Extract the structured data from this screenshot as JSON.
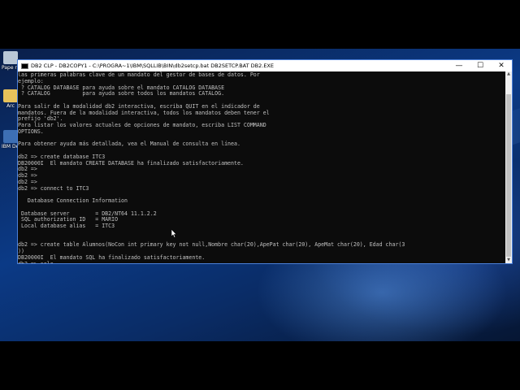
{
  "window": {
    "title": "DB2 CLP - DB2COPY1 - C:\\PROGRA~1\\IBM\\SQLLIB\\BIN\\db2setcp.bat  DB2SETCP.BAT DB2.EXE",
    "minimize": "—",
    "maximize": "☐",
    "close": "✕"
  },
  "desktop_icons": [
    {
      "label": "Pape rec",
      "icon": "recycle-bin-icon",
      "color": "#b9c7d6"
    },
    {
      "label": "Arc",
      "icon": "folder-icon",
      "color": "#e8c25a"
    },
    {
      "label": "IBM Devel",
      "icon": "ibm-app-icon",
      "color": "#3d6fb4"
    }
  ],
  "console_lines": [
    "las primeras palabras clave de un mandato del gestor de bases de datos. Por",
    "ejemplo:",
    " ? CATALOG DATABASE para ayuda sobre el mandato CATALOG DATABASE",
    " ? CATALOG          para ayuda sobre todos los mandatos CATALOG.",
    "",
    "Para salir de la modalidad db2 interactiva, escriba QUIT en el indicador de",
    "mandatos. Fuera de la modalidad interactiva, todos los mandatos deben tener el",
    "prefijo 'db2'.",
    "Para listar los valores actuales de opciones de mandato, escriba LIST COMMAND",
    "OPTIONS.",
    "",
    "Para obtener ayuda más detallada, vea el Manual de consulta en línea.",
    "",
    "db2 => create database ITC3",
    "DB20000I  El mandato CREATE DATABASE ha finalizado satisfactoriamente.",
    "db2 =>",
    "db2 =>",
    "db2 =>",
    "db2 => connect to ITC3",
    "",
    "   Database Connection Information",
    "",
    " Database server        = DB2/NT64 11.1.2.2",
    " SQL authorization ID   = MARIO",
    " Local database alias   = ITC3",
    "",
    "",
    "db2 => create table Alumnos(NoCon int primary key not null,Nombre char(20),ApePat char(20), ApeMat char(20), Edad char(3",
    "))",
    "DB20000I  El mandato SQL ha finalizado satisfactoriamente.",
    "db2 => sele"
  ],
  "colors": {
    "console_bg": "#0c0c0c",
    "console_text": "#c0c0c0",
    "window_border": "#4a7fd8"
  }
}
